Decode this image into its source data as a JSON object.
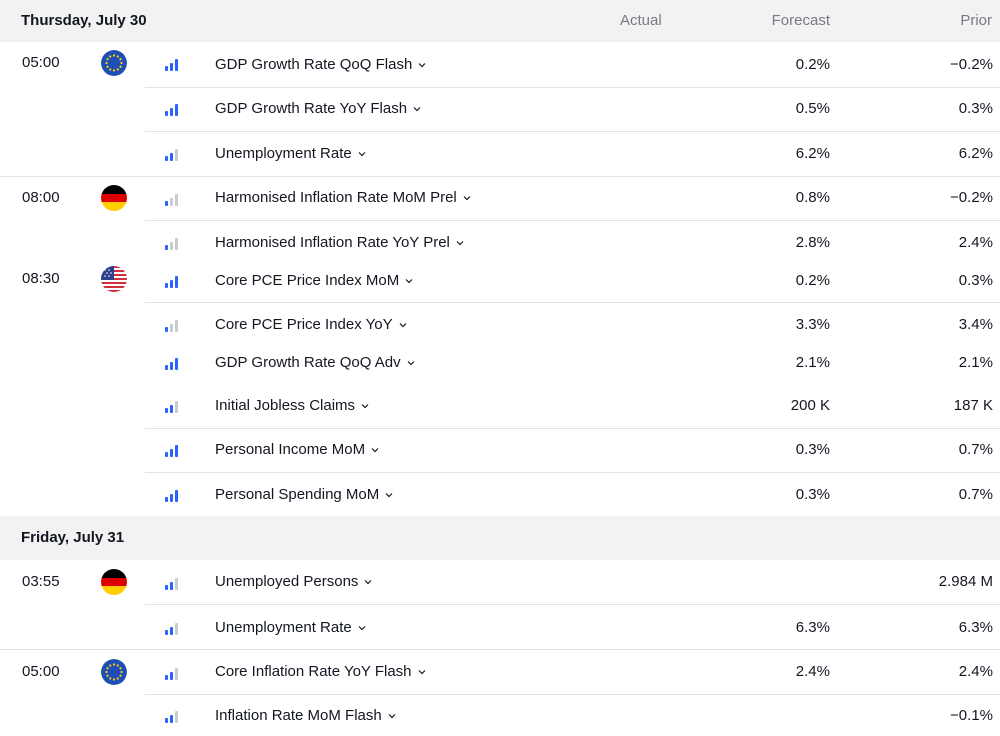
{
  "columns": {
    "actual": "Actual",
    "forecast": "Forecast",
    "prior": "Prior"
  },
  "days": [
    {
      "title": "Thursday, July 30",
      "groups": [
        {
          "time": "05:00",
          "country": "eu-flag-icon",
          "events": [
            {
              "name": "GDP Growth Rate QoQ Flash",
              "importance": 3,
              "forecast": "0.2%",
              "prior": "−0.2%"
            },
            {
              "name": "GDP Growth Rate YoY Flash",
              "importance": 3,
              "forecast": "0.5%",
              "prior": "0.3%"
            },
            {
              "name": "Unemployment Rate",
              "importance": 2,
              "forecast": "6.2%",
              "prior": "6.2%"
            }
          ]
        },
        {
          "time": "08:00",
          "country": "germany-flag-icon",
          "events": [
            {
              "name": "Harmonised Inflation Rate MoM Prel",
              "importance": 1,
              "forecast": "0.8%",
              "prior": "−0.2%"
            },
            {
              "name": "Harmonised Inflation Rate YoY Prel",
              "importance": 1,
              "forecast": "2.8%",
              "prior": "2.4%"
            }
          ]
        },
        {
          "time": "08:30",
          "country": "us-flag-icon",
          "events": [
            {
              "name": "Core PCE Price Index MoM",
              "importance": 3,
              "forecast": "0.2%",
              "prior": "0.3%"
            },
            {
              "name": "Core PCE Price Index YoY",
              "importance": 1,
              "forecast": "3.3%",
              "prior": "3.4%"
            },
            {
              "name": "GDP Growth Rate QoQ Adv",
              "importance": 3,
              "forecast": "2.1%",
              "prior": "2.1%"
            },
            {
              "name": "Initial Jobless Claims",
              "importance": 2,
              "forecast": "200 K",
              "prior": "187 K"
            },
            {
              "name": "Personal Income MoM",
              "importance": 3,
              "forecast": "0.3%",
              "prior": "0.7%"
            },
            {
              "name": "Personal Spending MoM",
              "importance": 3,
              "forecast": "0.3%",
              "prior": "0.7%"
            }
          ]
        }
      ]
    },
    {
      "title": "Friday, July 31",
      "groups": [
        {
          "time": "03:55",
          "country": "germany-flag-icon",
          "events": [
            {
              "name": "Unemployed Persons",
              "importance": 2,
              "forecast": "",
              "prior": "2.984 M"
            },
            {
              "name": "Unemployment Rate",
              "importance": 2,
              "forecast": "6.3%",
              "prior": "6.3%"
            }
          ]
        },
        {
          "time": "05:00",
          "country": "eu-flag-icon",
          "events": [
            {
              "name": "Core Inflation Rate YoY Flash",
              "importance": 2,
              "forecast": "2.4%",
              "prior": "2.4%"
            },
            {
              "name": "Inflation Rate MoM Flash",
              "importance": 2,
              "forecast": "",
              "prior": "−0.1%"
            }
          ]
        }
      ]
    }
  ]
}
